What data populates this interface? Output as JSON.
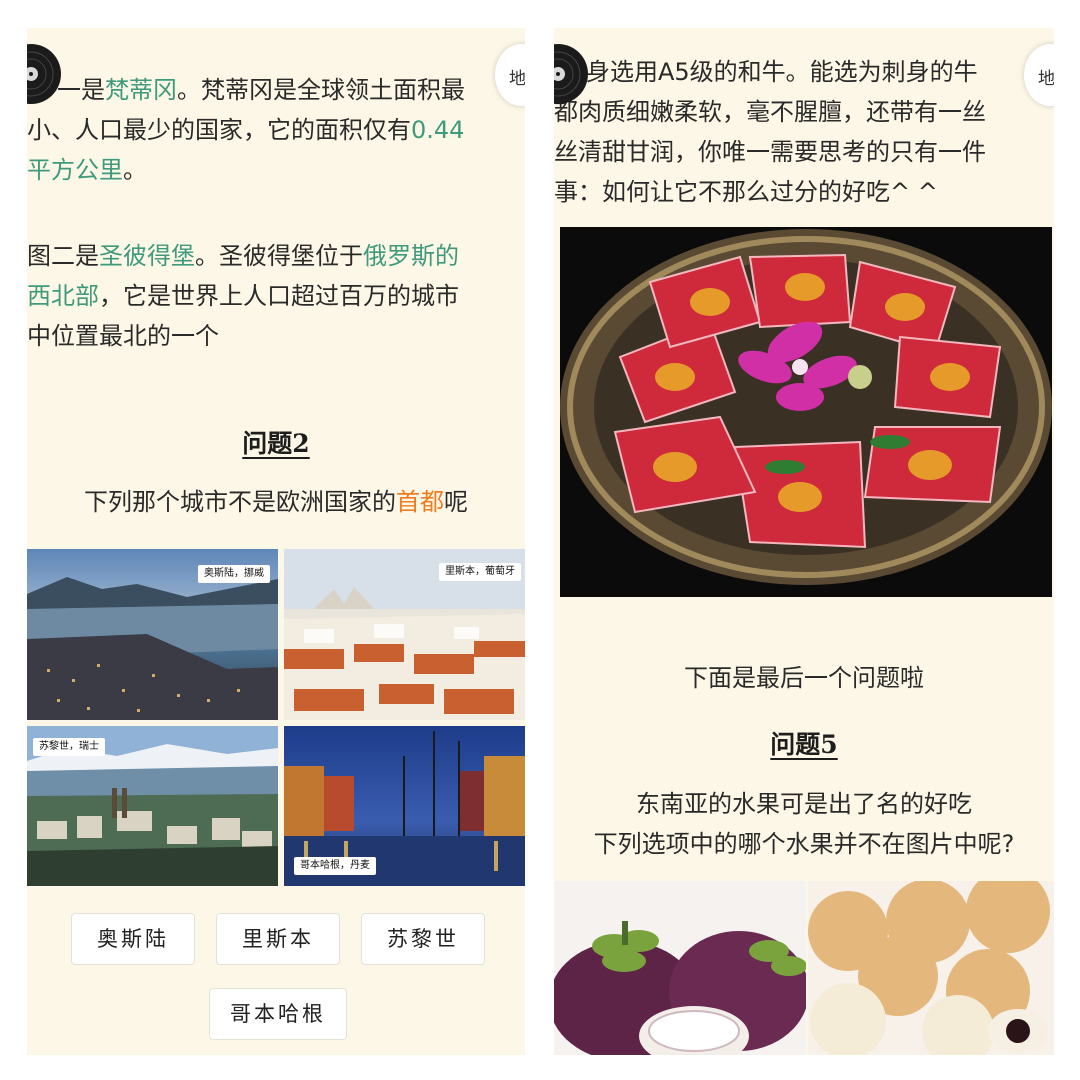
{
  "left": {
    "floating_badge": "地",
    "intro_prefix": "一是",
    "intro_place": "梵蒂冈",
    "intro_mid": "。梵蒂冈是全球领土面积最",
    "intro_line2": "小、人口最少的国家，它的面积仅有",
    "intro_area1": "0.44",
    "intro_area2": "平方公里",
    "intro_end": "。",
    "p2_prefix": "图二是",
    "p2_place": "圣彼得堡",
    "p2_mid": "。圣彼得堡位于",
    "p2_loc1": "俄罗斯的",
    "p2_loc2": "西北部",
    "p2_line2_rest": "，它是世界上人口超过百万的城市",
    "p2_line3": "中位置最北的一个",
    "question_title": "问题2",
    "question_prefix": "下列那个城市不是欧洲国家的",
    "question_keyword": "首都",
    "question_suffix": "呢",
    "photos": [
      {
        "caption": "奥斯陆，挪威",
        "icon": "city-photo"
      },
      {
        "caption": "里斯本，葡萄牙",
        "icon": "city-photo"
      },
      {
        "caption": "苏黎世，瑞士",
        "icon": "city-photo"
      },
      {
        "caption": "哥本哈根，丹麦",
        "icon": "city-photo"
      }
    ],
    "options": [
      "奥斯陆",
      "里斯本",
      "苏黎世",
      "哥本哈根"
    ]
  },
  "right": {
    "floating_badge": "地",
    "line1": "身选用A5级的和牛。能选为刺身的牛",
    "line2": "都肉质细嫩柔软，毫不腥膻，还带有一丝",
    "line3": "丝清甜甘润，你唯一需要思考的只有一件",
    "line4": "事：如何让它不那么过分的好吃^ ^",
    "last_question_intro": "下面是最后一个问题啦",
    "question_title": "问题5",
    "question_line1": "东南亚的水果可是出了名的好吃",
    "question_line2": "下列选项中的哪个水果并不在图片中呢?"
  },
  "colors": {
    "panel_bg": "#fdf7e7",
    "highlight_green": "#3f9a7c",
    "highlight_orange": "#ee7d22"
  }
}
